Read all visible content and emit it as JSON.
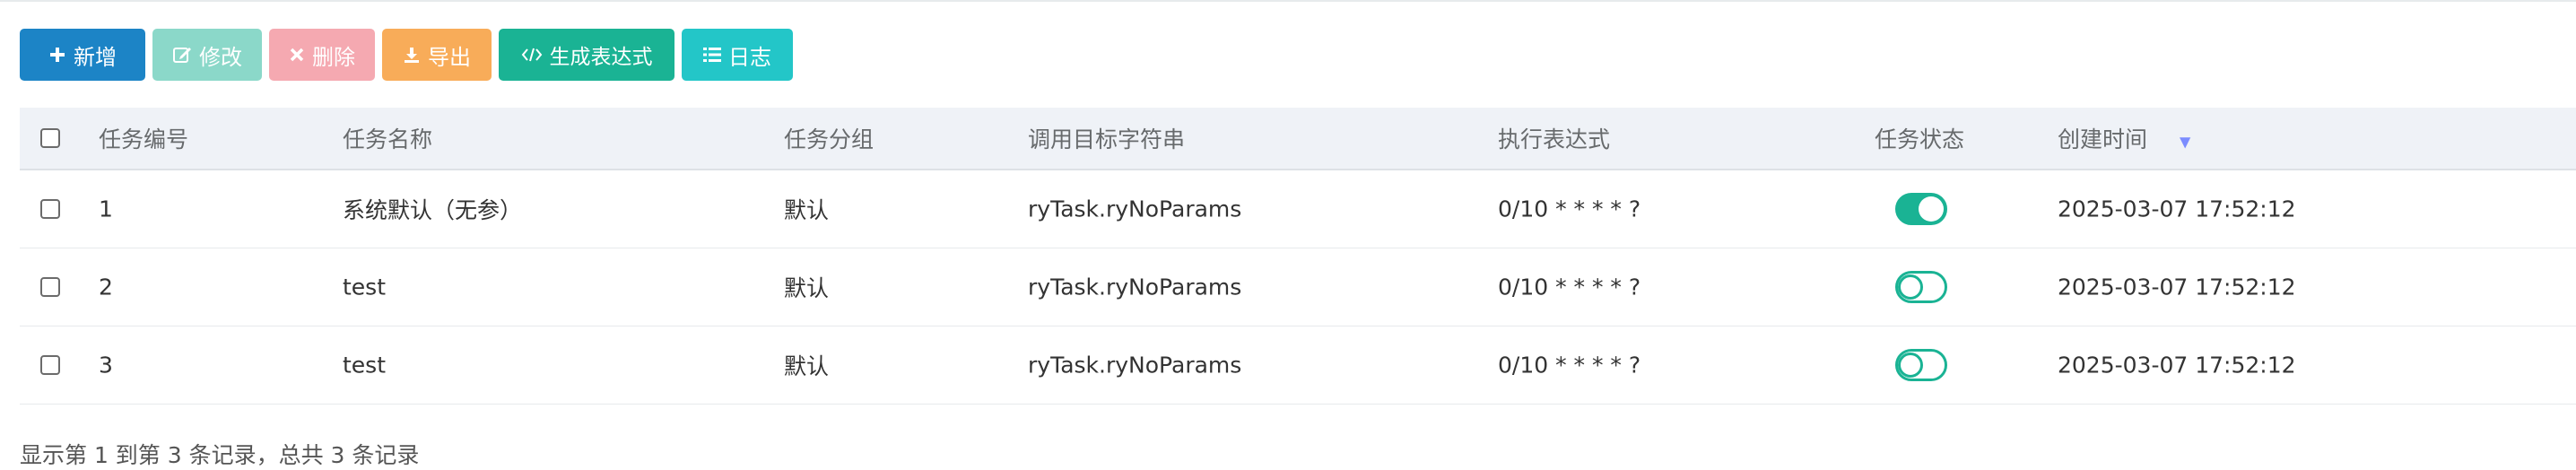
{
  "toolbar": {
    "add_label": "新增",
    "edit_label": "修改",
    "delete_label": "删除",
    "export_label": "导出",
    "generate_label": "生成表达式",
    "log_label": "日志"
  },
  "table": {
    "headers": {
      "id": "任务编号",
      "name": "任务名称",
      "group": "任务分组",
      "target": "调用目标字符串",
      "cron": "执行表达式",
      "status": "任务状态",
      "created": "创建时间"
    },
    "rows": [
      {
        "id": "1",
        "name": "系统默认（无参）",
        "group": "默认",
        "target": "ryTask.ryNoParams",
        "cron": "0/10 * * * * ?",
        "status_on": true,
        "created": "2025-03-07 17:52:12"
      },
      {
        "id": "2",
        "name": "test",
        "group": "默认",
        "target": "ryTask.ryNoParams",
        "cron": "0/10 * * * * ?",
        "status_on": false,
        "created": "2025-03-07 17:52:12"
      },
      {
        "id": "3",
        "name": "test",
        "group": "默认",
        "target": "ryTask.ryNoParams",
        "cron": "0/10 * * * * ?",
        "status_on": false,
        "created": "2025-03-07 17:52:12"
      }
    ]
  },
  "pagination": {
    "summary": "显示第 1 到第 3 条记录，总共 3 条记录"
  },
  "colors": {
    "primary": "#1c84c6",
    "success": "#1ab394",
    "danger": "#ed5565",
    "warning": "#f8ac59",
    "info": "#23c6c8"
  }
}
